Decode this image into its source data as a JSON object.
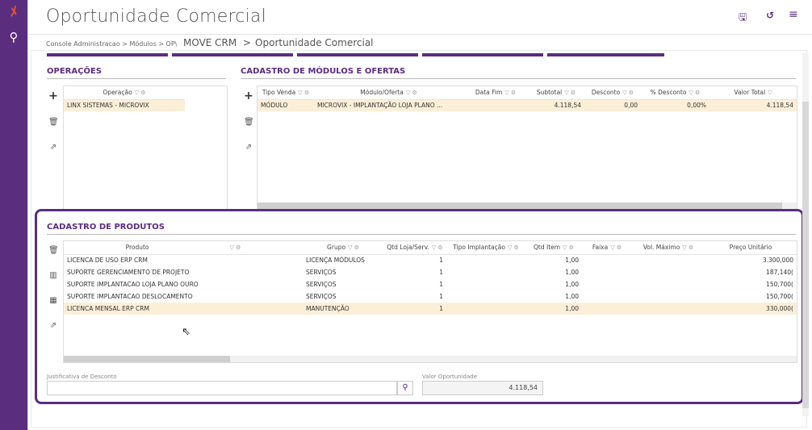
{
  "app": {
    "title": "Oportunidade Comercial",
    "toolbar": {
      "save_icon": "save-icon",
      "undo_icon": "undo-icon",
      "menu_icon": "menu-icon"
    }
  },
  "breadcrumb": {
    "part1": "Console Administracao > Módulos > OP\\",
    "part2": "MOVE CRM",
    "sep": ">",
    "part3": "Oportunidade Comercial"
  },
  "colors": {
    "accent": "#5a2d7f",
    "selected_row": "#fcefd8",
    "logo": "#e8552a"
  },
  "operacoes": {
    "title": "OPERAÇÕES",
    "column": "Operação",
    "rows": [
      "LINX SISTEMAS - MICROVIX"
    ]
  },
  "modulos": {
    "title": "CADASTRO DE MÓDULOS E OFERTAS",
    "columns": [
      "Tipo Venda",
      "Módulo/Oferta",
      "Data Fim",
      "Subtotal",
      "Desconto",
      "% Desconto",
      "Valor Total"
    ],
    "rows": [
      [
        "MÓDULO",
        "MICROVIX - IMPLANTAÇÃO LOJA PLANO ...",
        "",
        "4.118,54",
        "0,00",
        "0,00%",
        "4.118,54"
      ]
    ]
  },
  "produtos": {
    "title": "CADASTRO DE PRODUTOS",
    "columns": [
      "Produto",
      "Grupo",
      "Qtd Loja/Serv.",
      "Tipo Implantação",
      "Qtd Item",
      "Faixa",
      "Vol. Máximo",
      "Preço Unitário"
    ],
    "rows": [
      [
        "LICENCA DE USO ERP CRM",
        "LICENÇA MÓDULOS",
        "1",
        "",
        "1,00",
        "",
        "",
        "3.300,000"
      ],
      [
        "SUPORTE GERENCIAMENTO DE PROJETO",
        "SERVIÇOS",
        "1",
        "",
        "1,00",
        "",
        "",
        "187,140("
      ],
      [
        "SUPORTE IMPLANTACAO LOJA PLANO OURO",
        "SERVIÇOS",
        "1",
        "",
        "1,00",
        "",
        "",
        "150,700("
      ],
      [
        "SUPORTE IMPLANTACAO DESLOCAMENTO",
        "SERVIÇOS",
        "1",
        "",
        "1,00",
        "",
        "",
        "150,700("
      ],
      [
        "LICENCA MENSAL ERP CRM",
        "MANUTENÇÃO",
        "1",
        "",
        "1,00",
        "",
        "",
        "330,000("
      ]
    ]
  },
  "footer": {
    "justificativa_label": "Justificativa de Desconto",
    "justificativa_value": "",
    "valor_label": "Valor Oportunidade",
    "valor_value": "4.118,54"
  }
}
